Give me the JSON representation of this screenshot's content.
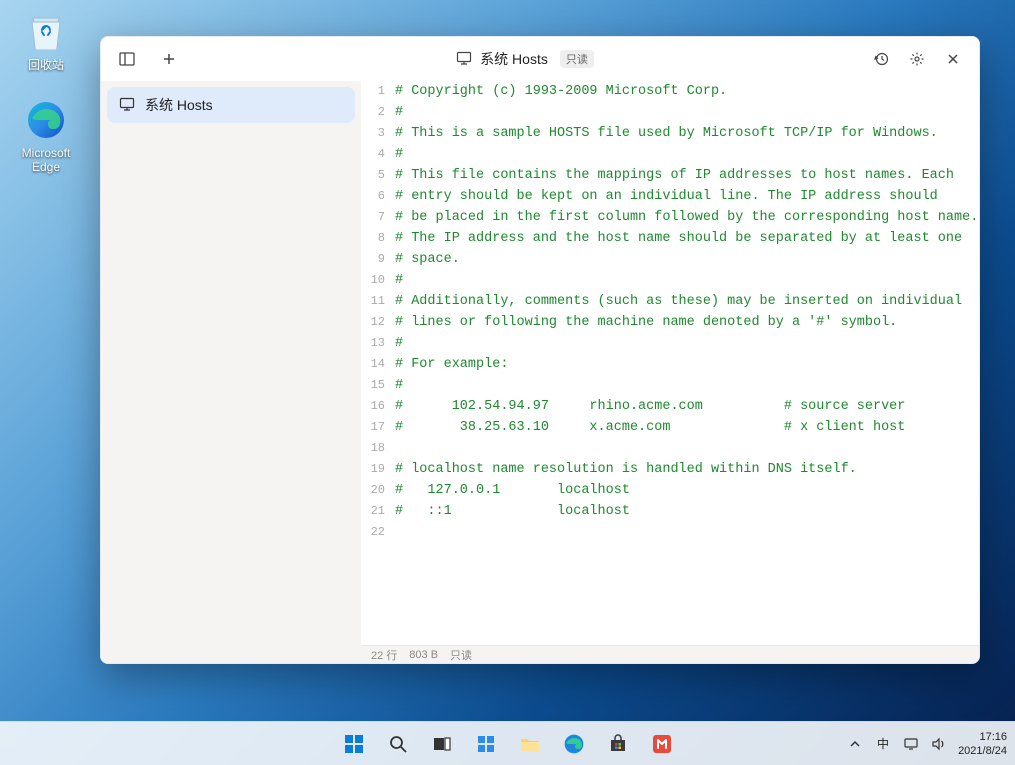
{
  "desktop": {
    "recycle_label": "回收站",
    "edge_label": "Microsoft Edge"
  },
  "window": {
    "title": "系统 Hosts",
    "readonly_badge": "只读",
    "sidebar": {
      "items": [
        {
          "label": "系统 Hosts"
        }
      ]
    },
    "statusbar": {
      "lines": "22 行",
      "bytes": "803 B",
      "readonly": "只读"
    },
    "code_lines": [
      "# Copyright (c) 1993-2009 Microsoft Corp.",
      "#",
      "# This is a sample HOSTS file used by Microsoft TCP/IP for Windows.",
      "#",
      "# This file contains the mappings of IP addresses to host names. Each",
      "# entry should be kept on an individual line. The IP address should",
      "# be placed in the first column followed by the corresponding host name.",
      "# The IP address and the host name should be separated by at least one",
      "# space.",
      "#",
      "# Additionally, comments (such as these) may be inserted on individual",
      "# lines or following the machine name denoted by a '#' symbol.",
      "#",
      "# For example:",
      "#",
      "#      102.54.94.97     rhino.acme.com          # source server",
      "#       38.25.63.10     x.acme.com              # x client host",
      "",
      "# localhost name resolution is handled within DNS itself.",
      "#   127.0.0.1       localhost",
      "#   ::1             localhost",
      ""
    ]
  },
  "taskbar": {
    "ime": "中",
    "time": "17:16",
    "date": "2021/8/24"
  }
}
